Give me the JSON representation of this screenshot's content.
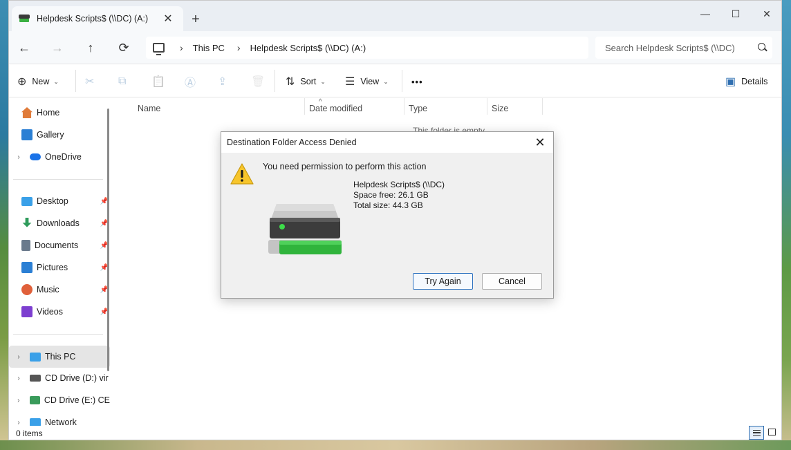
{
  "window": {
    "tab_title": "Helpdesk Scripts$ (\\\\DC) (A:)",
    "tab_close": "✕",
    "new_tab": "+",
    "minimize": "—",
    "maximize": "☐",
    "close": "✕"
  },
  "nav": {
    "back": "←",
    "forward": "→",
    "up": "↑",
    "refresh": "⟳",
    "breadcrumb": [
      "This PC",
      "Helpdesk Scripts$ (\\\\DC) (A:)"
    ],
    "separator": "›",
    "search_placeholder": "Search Helpdesk Scripts$ (\\\\DC)"
  },
  "toolbar": {
    "new_label": "New",
    "sort_label": "Sort",
    "view_label": "View",
    "more_label": "•••",
    "details_label": "Details",
    "caret": "⌄",
    "icons": {
      "new": "⊕",
      "cut": "✂",
      "copy": "⧉",
      "paste": "📋",
      "rename": "Ⓐ",
      "share": "⇪",
      "delete": "🗑",
      "sort": "⇅",
      "view": "☰",
      "details": "▣"
    }
  },
  "sidebar": {
    "items": [
      {
        "label": "Home",
        "icon": "home-icon",
        "color": "#e07b39"
      },
      {
        "label": "Gallery",
        "icon": "gallery-icon",
        "color": "#2b7fd4"
      },
      {
        "label": "OneDrive",
        "icon": "onedrive-icon",
        "color": "#1a73e8"
      },
      {
        "label": "Desktop",
        "icon": "desktop-icon",
        "color": "#3aa0e8"
      },
      {
        "label": "Downloads",
        "icon": "downloads-icon",
        "color": "#2e9b5b"
      },
      {
        "label": "Documents",
        "icon": "documents-icon",
        "color": "#6a7a8c"
      },
      {
        "label": "Pictures",
        "icon": "pictures-icon",
        "color": "#2b7fd4"
      },
      {
        "label": "Music",
        "icon": "music-icon",
        "color": "#e0603a"
      },
      {
        "label": "Videos",
        "icon": "videos-icon",
        "color": "#7d3fd0"
      },
      {
        "label": "This PC",
        "icon": "this-pc-icon",
        "color": "#3aa0e8"
      },
      {
        "label": "CD Drive (D:) vir",
        "icon": "cd-drive-icon",
        "color": "#555555"
      },
      {
        "label": "CD Drive (E:) CE",
        "icon": "cd-drive-icon",
        "color": "#3a9b5b"
      },
      {
        "label": "Network",
        "icon": "network-icon",
        "color": "#3aa0e8"
      }
    ],
    "pin": "📌",
    "chevron": "›"
  },
  "columns": {
    "name": "Name",
    "date_modified": "Date modified",
    "type": "Type",
    "size": "Size",
    "sort_arrow": "^"
  },
  "content": {
    "empty_message": "This folder is empty."
  },
  "status": {
    "item_count": "0 items"
  },
  "dialog": {
    "title": "Destination Folder Access Denied",
    "close": "✕",
    "message": "You need permission to perform this action",
    "drive_name": "Helpdesk Scripts$ (\\\\DC)",
    "space_free": "Space free: 26.1 GB",
    "total_size": "Total size: 44.3 GB",
    "try_again_label": "Try Again",
    "cancel_label": "Cancel",
    "warning_color": "#f7c52b"
  }
}
